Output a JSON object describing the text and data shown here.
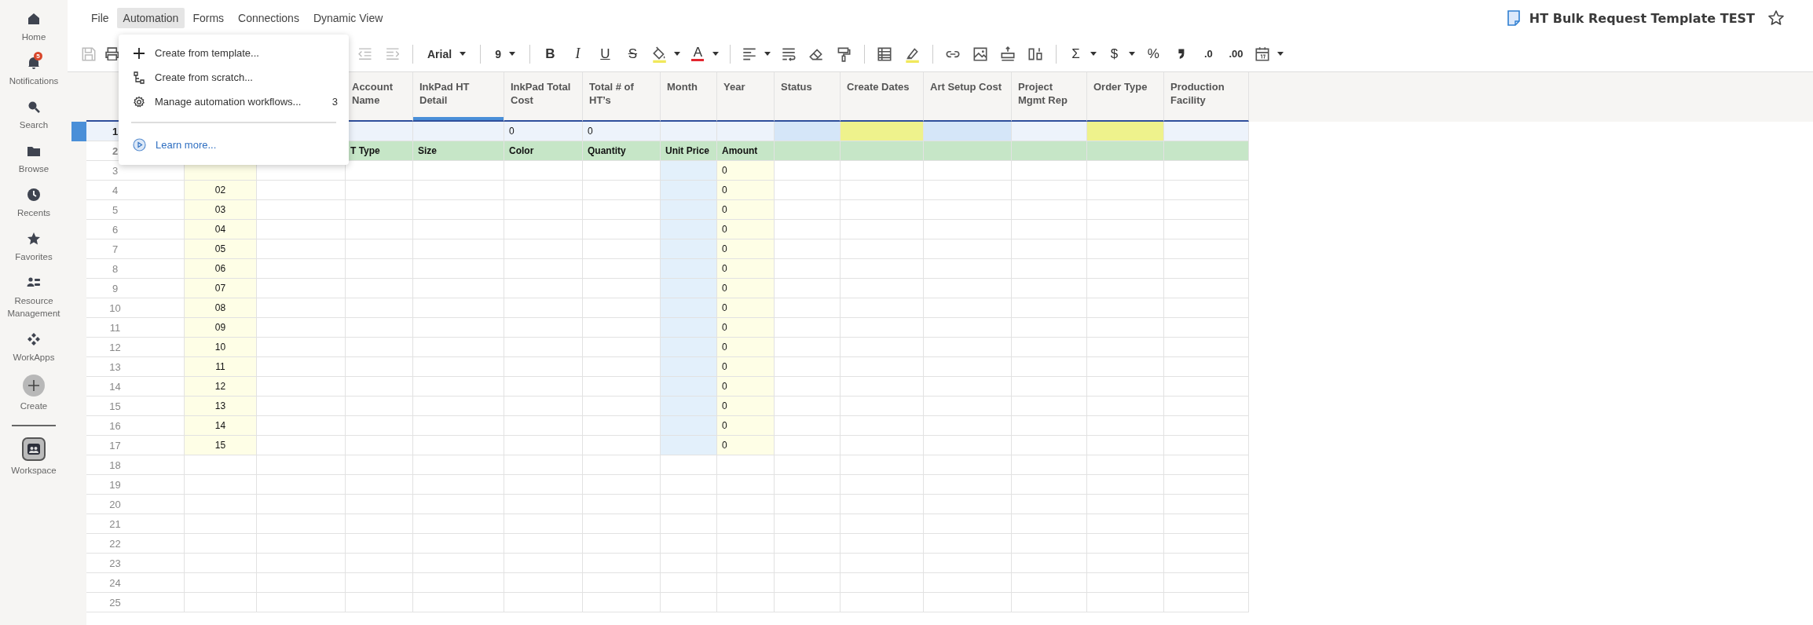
{
  "sidebar": {
    "items": [
      {
        "label": "Home",
        "kind": "nav"
      },
      {
        "label": "Notifications",
        "kind": "nav",
        "badge": "5"
      },
      {
        "label": "Search",
        "kind": "nav"
      },
      {
        "label": "Browse",
        "kind": "nav"
      },
      {
        "label": "Recents",
        "kind": "nav"
      },
      {
        "label": "Favorites",
        "kind": "nav"
      },
      {
        "label": "Resource Management",
        "kind": "nav"
      },
      {
        "label": "WorkApps",
        "kind": "nav"
      },
      {
        "label": "Create",
        "kind": "create"
      },
      {
        "label": "Workspace",
        "kind": "workspace"
      }
    ]
  },
  "menu_bar": [
    {
      "label": "File",
      "selected": false
    },
    {
      "label": "Automation",
      "selected": true
    },
    {
      "label": "Forms",
      "selected": false
    },
    {
      "label": "Connections",
      "selected": false
    },
    {
      "label": "Dynamic View",
      "selected": false
    }
  ],
  "document": {
    "title": "HT Bulk Request Template TEST"
  },
  "toolbar": {
    "font": "Arial",
    "font_size": "9",
    "glyphs": [
      "B",
      "I",
      "U",
      "S",
      "A",
      "Σ",
      "$",
      "%",
      ".0",
      ".00"
    ]
  },
  "automation_menu": {
    "items": [
      {
        "label": "Create from template..."
      },
      {
        "label": "Create from scratch..."
      },
      {
        "label": "Manage automation workflows...",
        "count": "3"
      }
    ],
    "link": "Learn more..."
  },
  "sheet": {
    "columns": [
      {
        "header": "Account\nName",
        "selected": false
      },
      {
        "header": "InkPad HT\nDetail",
        "selected": true
      },
      {
        "header": "InkPad Total\nCost",
        "selected": false
      },
      {
        "header": "Total # of\nHT’s",
        "selected": false
      },
      {
        "header": "Month",
        "selected": false
      },
      {
        "header": "Year",
        "selected": false
      },
      {
        "header": "Status",
        "selected": false
      },
      {
        "header": "Create Dates",
        "selected": false
      },
      {
        "header": "Art Setup Cost",
        "selected": false
      },
      {
        "header": "Project\nMgmt Rep",
        "selected": false
      },
      {
        "header": "Order Type",
        "selected": false
      },
      {
        "header": "Production\nFacility",
        "selected": false
      }
    ],
    "rows": [
      {
        "number": "1",
        "kind": "data",
        "selected": true,
        "cells": [
          {},
          {},
          {},
          {},
          {
            "text": "0"
          },
          {
            "text": "0"
          },
          {},
          {},
          {
            "color": "#d5e6f8"
          },
          {
            "color": "#eef28c"
          },
          {
            "color": "#d5e6f8"
          },
          {},
          {
            "color": "#eef28c"
          }
        ]
      },
      {
        "number": "2",
        "kind": "labels",
        "selected": false,
        "color": "#c6e6c7",
        "cells": [
          {},
          {},
          {
            "text": "T Type"
          },
          {
            "text": "Size"
          },
          {
            "text": "Color"
          },
          {
            "text": "Quantity"
          },
          {
            "text": "Unit Price"
          },
          {
            "text": "Amount"
          }
        ]
      },
      {
        "number": "3",
        "kind": "data",
        "selected": false,
        "cells": [
          {
            "color": "#fefee6"
          },
          {},
          {},
          {},
          {},
          {},
          {
            "color": "#e3f0fb"
          },
          {
            "text": "0",
            "color": "#fefee6"
          }
        ]
      },
      {
        "number": "4",
        "kind": "data",
        "selected": false,
        "cells": [
          {
            "text": "02",
            "color": "#fefee6"
          },
          {},
          {},
          {},
          {},
          {},
          {
            "color": "#e3f0fb"
          },
          {
            "text": "0",
            "color": "#fefee6"
          }
        ]
      },
      {
        "number": "5",
        "kind": "data",
        "selected": false,
        "cells": [
          {
            "text": "03",
            "color": "#fefee6"
          },
          {},
          {},
          {},
          {},
          {},
          {
            "color": "#e3f0fb"
          },
          {
            "text": "0",
            "color": "#fefee6"
          }
        ]
      },
      {
        "number": "6",
        "kind": "data",
        "selected": false,
        "cells": [
          {
            "text": "04",
            "color": "#fefee6"
          },
          {},
          {},
          {},
          {},
          {},
          {
            "color": "#e3f0fb"
          },
          {
            "text": "0",
            "color": "#fefee6"
          }
        ]
      },
      {
        "number": "7",
        "kind": "data",
        "selected": false,
        "cells": [
          {
            "text": "05",
            "color": "#fefee6"
          },
          {},
          {},
          {},
          {},
          {},
          {
            "color": "#e3f0fb"
          },
          {
            "text": "0",
            "color": "#fefee6"
          }
        ]
      },
      {
        "number": "8",
        "kind": "data",
        "selected": false,
        "cells": [
          {
            "text": "06",
            "color": "#fefee6"
          },
          {},
          {},
          {},
          {},
          {},
          {
            "color": "#e3f0fb"
          },
          {
            "text": "0",
            "color": "#fefee6"
          }
        ]
      },
      {
        "number": "9",
        "kind": "data",
        "selected": false,
        "cells": [
          {
            "text": "07",
            "color": "#fefee6"
          },
          {},
          {},
          {},
          {},
          {},
          {
            "color": "#e3f0fb"
          },
          {
            "text": "0",
            "color": "#fefee6"
          }
        ]
      },
      {
        "number": "10",
        "kind": "data",
        "selected": false,
        "cells": [
          {
            "text": "08",
            "color": "#fefee6"
          },
          {},
          {},
          {},
          {},
          {},
          {
            "color": "#e3f0fb"
          },
          {
            "text": "0",
            "color": "#fefee6"
          }
        ]
      },
      {
        "number": "11",
        "kind": "data",
        "selected": false,
        "cells": [
          {
            "text": "09",
            "color": "#fefee6"
          },
          {},
          {},
          {},
          {},
          {},
          {
            "color": "#e3f0fb"
          },
          {
            "text": "0",
            "color": "#fefee6"
          }
        ]
      },
      {
        "number": "12",
        "kind": "data",
        "selected": false,
        "cells": [
          {
            "text": "10",
            "color": "#fefee6"
          },
          {},
          {},
          {},
          {},
          {},
          {
            "color": "#e3f0fb"
          },
          {
            "text": "0",
            "color": "#fefee6"
          }
        ]
      },
      {
        "number": "13",
        "kind": "data",
        "selected": false,
        "cells": [
          {
            "text": "11",
            "color": "#fefee6"
          },
          {},
          {},
          {},
          {},
          {},
          {
            "color": "#e3f0fb"
          },
          {
            "text": "0",
            "color": "#fefee6"
          }
        ]
      },
      {
        "number": "14",
        "kind": "data",
        "selected": false,
        "cells": [
          {
            "text": "12",
            "color": "#fefee6"
          },
          {},
          {},
          {},
          {},
          {},
          {
            "color": "#e3f0fb"
          },
          {
            "text": "0",
            "color": "#fefee6"
          }
        ]
      },
      {
        "number": "15",
        "kind": "data",
        "selected": false,
        "cells": [
          {
            "text": "13",
            "color": "#fefee6"
          },
          {},
          {},
          {},
          {},
          {},
          {
            "color": "#e3f0fb"
          },
          {
            "text": "0",
            "color": "#fefee6"
          }
        ]
      },
      {
        "number": "16",
        "kind": "data",
        "selected": false,
        "cells": [
          {
            "text": "14",
            "color": "#fefee6"
          },
          {},
          {},
          {},
          {},
          {},
          {
            "color": "#e3f0fb"
          },
          {
            "text": "0",
            "color": "#fefee6"
          }
        ]
      },
      {
        "number": "17",
        "kind": "data",
        "selected": false,
        "cells": [
          {
            "text": "15",
            "color": "#fefee6"
          },
          {},
          {},
          {},
          {},
          {},
          {
            "color": "#e3f0fb"
          },
          {
            "text": "0",
            "color": "#fefee6"
          }
        ]
      },
      {
        "number": "18",
        "kind": "data",
        "selected": false
      },
      {
        "number": "19",
        "kind": "data",
        "selected": false
      },
      {
        "number": "20",
        "kind": "data",
        "selected": false
      },
      {
        "number": "21",
        "kind": "data",
        "selected": false
      },
      {
        "number": "22",
        "kind": "data",
        "selected": false
      },
      {
        "number": "23",
        "kind": "data",
        "selected": false
      },
      {
        "number": "24",
        "kind": "data",
        "selected": false
      },
      {
        "number": "25",
        "kind": "data",
        "selected": false
      }
    ]
  }
}
